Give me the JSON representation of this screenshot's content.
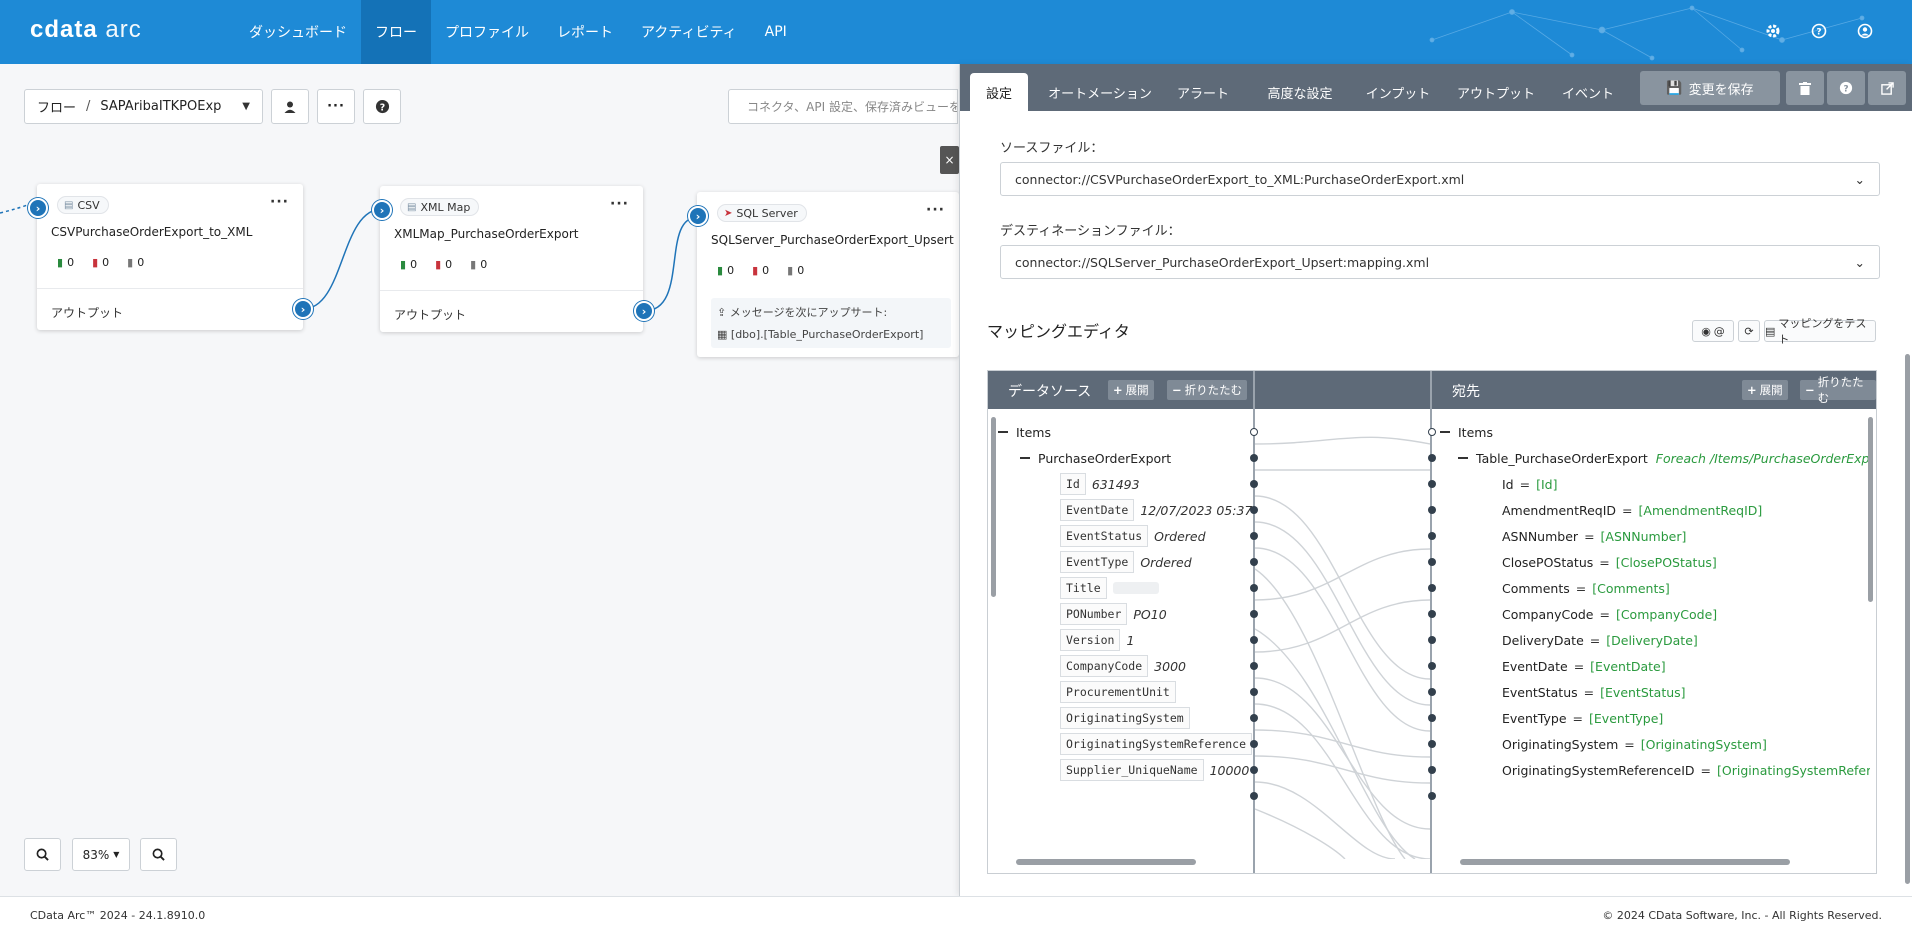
{
  "app": {
    "logo_bold": "cdata",
    "logo_light": "arc"
  },
  "nav": {
    "items": [
      {
        "label": "ダッシュボード",
        "active": false
      },
      {
        "label": "フロー",
        "active": true
      },
      {
        "label": "プロファイル",
        "active": false
      },
      {
        "label": "レポート",
        "active": false
      },
      {
        "label": "アクティビティ",
        "active": false
      },
      {
        "label": "API",
        "active": false
      }
    ],
    "icons": [
      "gear-icon",
      "help-icon",
      "user-icon"
    ]
  },
  "flow_toolbar": {
    "breadcrumb_root": "フロー",
    "breadcrumb_sep": "/",
    "flow_name": "SAPAribaITKPOExp",
    "search_placeholder": "コネクタ、API 設定、保存済みビューを検",
    "close_label": "×"
  },
  "cards": [
    {
      "badge": "CSV",
      "name": "CSVPurchaseOrderExport_to_XML",
      "counts": [
        "0",
        "0",
        "0"
      ],
      "output_label": "アウトプット"
    },
    {
      "badge": "XML Map",
      "name": "XMLMap_PurchaseOrderExport",
      "counts": [
        "0",
        "0",
        "0"
      ],
      "output_label": "アウトプット"
    },
    {
      "badge": "SQL Server",
      "name": "SQLServer_PurchaseOrderExport_Upsert",
      "counts": [
        "0",
        "0",
        "0"
      ],
      "upsert_label": "メッセージを次にアップサート:",
      "upsert_table": "[dbo].[Table_PurchaseOrderExport]"
    }
  ],
  "zoom": {
    "level": "83%"
  },
  "footer": {
    "left": "CData Arc™ 2024 - 24.1.8910.0",
    "right": "© 2024 CData Software, Inc. - All Rights Reserved."
  },
  "panel": {
    "tabs": [
      "設定",
      "オートメーション",
      "アラート",
      "高度な設定",
      "インプット",
      "アウトプット",
      "イベント"
    ],
    "active_tab": 0,
    "save_label": "変更を保存",
    "source_label": "ソースファイル：",
    "source_value": "connector://CSVPurchaseOrderExport_to_XML:PurchaseOrderExport.xml",
    "dest_label": "デスティネーションファイル：",
    "dest_value": "connector://SQLServer_PurchaseOrderExport_Upsert:mapping.xml",
    "mapping_editor_title": "マッピングエディタ",
    "tools": {
      "toggle_label": "@",
      "test_label": "マッピングをテスト"
    }
  },
  "mapper": {
    "source_header": "データソース",
    "dest_header": "宛先",
    "expand_label": "展開",
    "collapse_label": "折りたたむ",
    "source_root": "Items",
    "source_node": "PurchaseOrderExport",
    "source_fields": [
      {
        "name": "Id",
        "value": "631493"
      },
      {
        "name": "EventDate",
        "value": "12/07/2023 05:37"
      },
      {
        "name": "EventStatus",
        "value": "Ordered"
      },
      {
        "name": "EventType",
        "value": "Ordered"
      },
      {
        "name": "Title",
        "value": ""
      },
      {
        "name": "PONumber",
        "value": "PO10"
      },
      {
        "name": "Version",
        "value": "1"
      },
      {
        "name": "CompanyCode",
        "value": "3000"
      },
      {
        "name": "ProcurementUnit",
        "value": ""
      },
      {
        "name": "OriginatingSystem",
        "value": ""
      },
      {
        "name": "OriginatingSystemReference",
        "value": ""
      },
      {
        "name": "Supplier_UniqueName",
        "value": "10000"
      }
    ],
    "dest_root": "Items",
    "dest_node": "Table_PurchaseOrderExport",
    "dest_foreach": "Foreach /Items/PurchaseOrderExp",
    "dest_fields": [
      {
        "name": "Id",
        "value": "[Id]"
      },
      {
        "name": "AmendmentReqID",
        "value": "[AmendmentReqID]"
      },
      {
        "name": "ASNNumber",
        "value": "[ASNNumber]"
      },
      {
        "name": "ClosePOStatus",
        "value": "[ClosePOStatus]"
      },
      {
        "name": "Comments",
        "value": "[Comments]"
      },
      {
        "name": "CompanyCode",
        "value": "[CompanyCode]"
      },
      {
        "name": "DeliveryDate",
        "value": "[DeliveryDate]"
      },
      {
        "name": "EventDate",
        "value": "[EventDate]"
      },
      {
        "name": "EventStatus",
        "value": "[EventStatus]"
      },
      {
        "name": "EventType",
        "value": "[EventType]"
      },
      {
        "name": "OriginatingSystem",
        "value": "[OriginatingSystem]"
      },
      {
        "name": "OriginatingSystemReferenceID",
        "value": "[OriginatingSystemRefer"
      }
    ],
    "eq": "="
  }
}
